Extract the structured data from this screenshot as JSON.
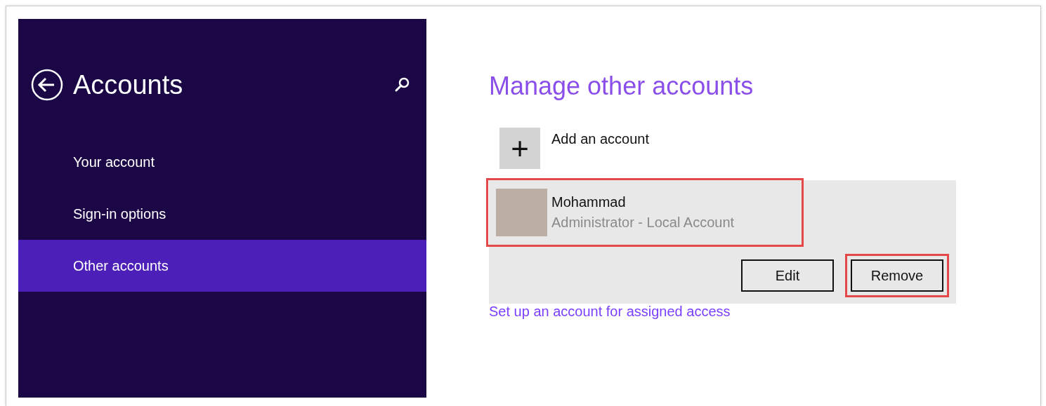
{
  "sidebar": {
    "title": "Accounts",
    "items": [
      {
        "label": "Your account",
        "selected": false
      },
      {
        "label": "Sign-in options",
        "selected": false
      },
      {
        "label": "Other accounts",
        "selected": true
      }
    ]
  },
  "main": {
    "title": "Manage other accounts",
    "add_account": {
      "label": "Add an account",
      "icon": "+"
    },
    "account": {
      "name": "Mohammad",
      "subtitle": "Administrator - Local Account",
      "highlighted": true
    },
    "buttons": [
      {
        "label": "Edit",
        "highlighted": false
      },
      {
        "label": "Remove",
        "highlighted": true
      }
    ],
    "link": "Set up an account for assigned access"
  }
}
